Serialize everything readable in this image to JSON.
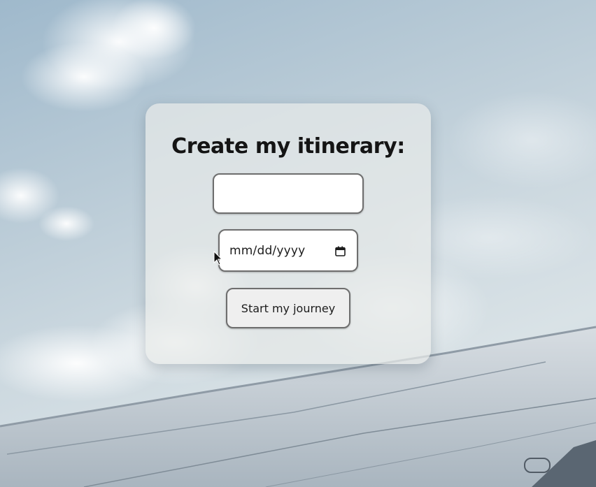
{
  "form": {
    "title": "Create my itinerary:",
    "destination_value": "",
    "date_placeholder": "mm/dd/yyyy",
    "submit_label": "Start my journey"
  },
  "icons": {
    "date_picker": "calendar-icon",
    "pointer": "mouse-cursor-icon"
  },
  "colors": {
    "sky": "#b8cad6",
    "card": "#e8eae9",
    "title_text": "#141414",
    "input_border": "#6e6e6e"
  }
}
